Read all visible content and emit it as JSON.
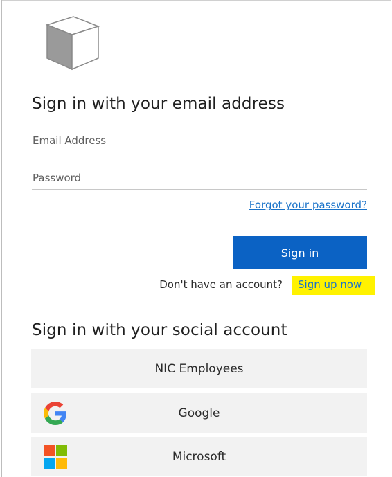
{
  "form": {
    "heading": "Sign in with your email address",
    "email_placeholder": "Email Address",
    "password_placeholder": "Password",
    "forgot_password": "Forgot your password?",
    "sign_in_label": "Sign in",
    "no_account_prompt": "Don't have an account?",
    "sign_up_label": "Sign up now"
  },
  "social": {
    "heading": "Sign in with your social account",
    "providers": [
      {
        "label": "NIC Employees",
        "icon": ""
      },
      {
        "label": "Google",
        "icon": "google-icon"
      },
      {
        "label": "Microsoft",
        "icon": "microsoft-icon"
      }
    ]
  },
  "colors": {
    "primary_button": "#0b62c4",
    "link": "#1a73c9",
    "highlight": "#fff200",
    "social_button_bg": "#f2f2f2",
    "focus_underline": "#2b6fd6"
  }
}
